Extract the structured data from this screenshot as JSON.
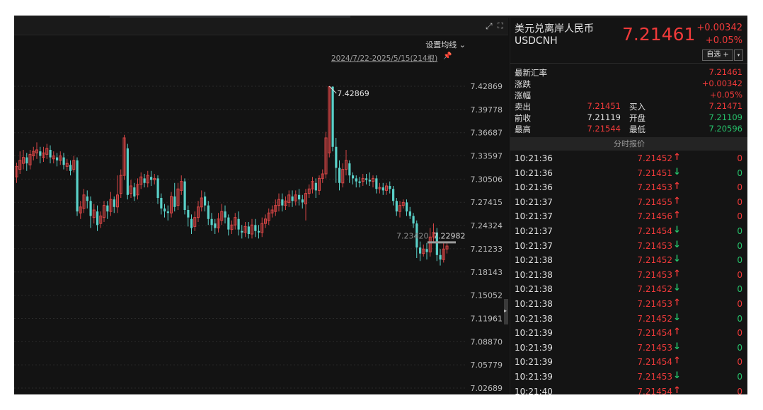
{
  "chart": {
    "ma_setting_label": "设置均线",
    "date_range_label": "2024/7/22-2025/5/15(214根)",
    "high_marker_label": "7.42869",
    "last_price_label": "7.23420",
    "last_price_label_2": "7.22982",
    "y_ticks": [
      "7.42869",
      "7.39778",
      "7.36687",
      "7.33597",
      "7.30506",
      "7.27415",
      "7.24324",
      "7.21233",
      "7.18143",
      "7.15052",
      "7.11961",
      "7.08870",
      "7.05779",
      "7.02689"
    ]
  },
  "chart_data": {
    "type": "candlestick",
    "title": "",
    "ylim": [
      7.02689,
      7.42869
    ],
    "high_marker": 7.42869,
    "last_labels": [
      7.2342,
      7.22982
    ],
    "ohlc": [
      [
        7.308,
        7.322,
        7.3,
        7.327
      ],
      [
        7.318,
        7.33,
        7.312,
        7.342
      ],
      [
        7.326,
        7.334,
        7.318,
        7.344
      ],
      [
        7.334,
        7.326,
        7.316,
        7.34
      ],
      [
        7.324,
        7.338,
        7.318,
        7.344
      ],
      [
        7.336,
        7.342,
        7.33,
        7.348
      ],
      [
        7.34,
        7.344,
        7.332,
        7.354
      ],
      [
        7.342,
        7.336,
        7.326,
        7.348
      ],
      [
        7.334,
        7.34,
        7.328,
        7.348
      ],
      [
        7.338,
        7.346,
        7.332,
        7.352
      ],
      [
        7.344,
        7.334,
        7.326,
        7.35
      ],
      [
        7.332,
        7.336,
        7.326,
        7.342
      ],
      [
        7.334,
        7.33,
        7.322,
        7.34
      ],
      [
        7.33,
        7.336,
        7.324,
        7.342
      ],
      [
        7.334,
        7.324,
        7.318,
        7.34
      ],
      [
        7.322,
        7.326,
        7.316,
        7.332
      ],
      [
        7.324,
        7.316,
        7.31,
        7.33
      ],
      [
        7.318,
        7.33,
        7.314,
        7.336
      ],
      [
        7.33,
        7.262,
        7.256,
        7.334
      ],
      [
        7.26,
        7.268,
        7.252,
        7.276
      ],
      [
        7.266,
        7.284,
        7.26,
        7.292
      ],
      [
        7.282,
        7.276,
        7.266,
        7.29
      ],
      [
        7.276,
        7.256,
        7.24,
        7.282
      ],
      [
        7.254,
        7.264,
        7.246,
        7.272
      ],
      [
        7.262,
        7.244,
        7.236,
        7.27
      ],
      [
        7.246,
        7.256,
        7.24,
        7.262
      ],
      [
        7.254,
        7.27,
        7.248,
        7.276
      ],
      [
        7.27,
        7.262,
        7.252,
        7.276
      ],
      [
        7.262,
        7.278,
        7.256,
        7.288
      ],
      [
        7.278,
        7.268,
        7.26,
        7.282
      ],
      [
        7.268,
        7.284,
        7.26,
        7.31
      ],
      [
        7.286,
        7.31,
        7.28,
        7.318
      ],
      [
        7.31,
        7.36,
        7.304,
        7.364
      ],
      [
        7.346,
        7.284,
        7.278,
        7.352
      ],
      [
        7.286,
        7.296,
        7.28,
        7.304
      ],
      [
        7.294,
        7.282,
        7.276,
        7.3
      ],
      [
        7.284,
        7.298,
        7.278,
        7.306
      ],
      [
        7.298,
        7.308,
        7.292,
        7.314
      ],
      [
        7.306,
        7.3,
        7.294,
        7.312
      ],
      [
        7.3,
        7.31,
        7.294,
        7.316
      ],
      [
        7.308,
        7.304,
        7.296,
        7.316
      ],
      [
        7.304,
        7.306,
        7.298,
        7.312
      ],
      [
        7.306,
        7.28,
        7.272,
        7.31
      ],
      [
        7.28,
        7.266,
        7.258,
        7.286
      ],
      [
        7.266,
        7.262,
        7.254,
        7.272
      ],
      [
        7.262,
        7.26,
        7.25,
        7.27
      ],
      [
        7.26,
        7.282,
        7.254,
        7.288
      ],
      [
        7.282,
        7.268,
        7.262,
        7.3
      ],
      [
        7.27,
        7.292,
        7.264,
        7.3
      ],
      [
        7.29,
        7.302,
        7.284,
        7.31
      ],
      [
        7.302,
        7.264,
        7.258,
        7.306
      ],
      [
        7.264,
        7.254,
        7.242,
        7.27
      ],
      [
        7.252,
        7.24,
        7.232,
        7.258
      ],
      [
        7.242,
        7.254,
        7.236,
        7.262
      ],
      [
        7.254,
        7.268,
        7.248,
        7.276
      ],
      [
        7.268,
        7.28,
        7.262,
        7.29
      ],
      [
        7.282,
        7.27,
        7.262,
        7.288
      ],
      [
        7.27,
        7.252,
        7.244,
        7.276
      ],
      [
        7.252,
        7.244,
        7.236,
        7.26
      ],
      [
        7.246,
        7.24,
        7.232,
        7.252
      ],
      [
        7.24,
        7.252,
        7.234,
        7.26
      ],
      [
        7.25,
        7.262,
        7.244,
        7.272
      ],
      [
        7.262,
        7.254,
        7.246,
        7.27
      ],
      [
        7.254,
        7.238,
        7.23,
        7.258
      ],
      [
        7.238,
        7.244,
        7.232,
        7.25
      ],
      [
        7.244,
        7.254,
        7.238,
        7.26
      ],
      [
        7.252,
        7.238,
        7.23,
        7.262
      ],
      [
        7.236,
        7.234,
        7.226,
        7.244
      ],
      [
        7.234,
        7.242,
        7.228,
        7.248
      ],
      [
        7.242,
        7.232,
        7.226,
        7.248
      ],
      [
        7.232,
        7.244,
        7.226,
        7.252
      ],
      [
        7.244,
        7.236,
        7.228,
        7.252
      ],
      [
        7.236,
        7.234,
        7.226,
        7.244
      ],
      [
        7.234,
        7.246,
        7.228,
        7.254
      ],
      [
        7.246,
        7.252,
        7.24,
        7.258
      ],
      [
        7.25,
        7.26,
        7.244,
        7.266
      ],
      [
        7.26,
        7.264,
        7.254,
        7.27
      ],
      [
        7.262,
        7.27,
        7.256,
        7.278
      ],
      [
        7.27,
        7.278,
        7.262,
        7.286
      ],
      [
        7.278,
        7.27,
        7.262,
        7.286
      ],
      [
        7.27,
        7.276,
        7.264,
        7.282
      ],
      [
        7.274,
        7.284,
        7.268,
        7.29
      ],
      [
        7.282,
        7.276,
        7.268,
        7.29
      ],
      [
        7.276,
        7.284,
        7.27,
        7.29
      ],
      [
        7.284,
        7.278,
        7.27,
        7.292
      ],
      [
        7.278,
        7.274,
        7.266,
        7.284
      ],
      [
        7.272,
        7.286,
        7.25,
        7.292
      ],
      [
        7.286,
        7.292,
        7.28,
        7.298
      ],
      [
        7.292,
        7.302,
        7.286,
        7.308
      ],
      [
        7.3,
        7.29,
        7.28,
        7.306
      ],
      [
        7.29,
        7.306,
        7.284,
        7.31
      ],
      [
        7.306,
        7.312,
        7.3,
        7.318
      ],
      [
        7.312,
        7.36,
        7.306,
        7.368
      ],
      [
        7.34,
        7.428,
        7.334,
        7.42869
      ],
      [
        7.428,
        7.348,
        7.342,
        7.42869
      ],
      [
        7.348,
        7.32,
        7.3,
        7.36
      ],
      [
        7.32,
        7.3,
        7.29,
        7.33
      ],
      [
        7.3,
        7.318,
        7.294,
        7.326
      ],
      [
        7.318,
        7.33,
        7.31,
        7.344
      ],
      [
        7.326,
        7.31,
        7.3,
        7.33
      ],
      [
        7.31,
        7.306,
        7.298,
        7.314
      ],
      [
        7.306,
        7.302,
        7.294,
        7.31
      ],
      [
        7.302,
        7.3,
        7.294,
        7.308
      ],
      [
        7.302,
        7.306,
        7.296,
        7.312
      ],
      [
        7.306,
        7.304,
        7.298,
        7.312
      ],
      [
        7.304,
        7.302,
        7.296,
        7.314
      ],
      [
        7.302,
        7.306,
        7.294,
        7.31
      ],
      [
        7.306,
        7.292,
        7.286,
        7.31
      ],
      [
        7.292,
        7.294,
        7.286,
        7.3
      ],
      [
        7.294,
        7.29,
        7.284,
        7.3
      ],
      [
        7.29,
        7.296,
        7.284,
        7.3
      ],
      [
        7.296,
        7.292,
        7.286,
        7.302
      ],
      [
        7.292,
        7.276,
        7.27,
        7.296
      ],
      [
        7.276,
        7.262,
        7.256,
        7.28
      ],
      [
        7.262,
        7.27,
        7.254,
        7.276
      ],
      [
        7.27,
        7.274,
        7.266,
        7.278
      ],
      [
        7.274,
        7.262,
        7.256,
        7.278
      ],
      [
        7.262,
        7.256,
        7.252,
        7.268
      ],
      [
        7.256,
        7.246,
        7.24,
        7.26
      ],
      [
        7.246,
        7.214,
        7.2,
        7.25
      ],
      [
        7.214,
        7.206,
        7.196,
        7.222
      ],
      [
        7.206,
        7.212,
        7.202,
        7.218
      ],
      [
        7.212,
        7.208,
        7.198,
        7.22
      ],
      [
        7.208,
        7.228,
        7.202,
        7.24
      ],
      [
        7.228,
        7.234,
        7.222,
        7.246
      ],
      [
        7.234,
        7.204,
        7.196,
        7.24
      ],
      [
        7.204,
        7.198,
        7.19,
        7.212
      ],
      [
        7.198,
        7.212,
        7.194,
        7.222
      ],
      [
        7.212,
        7.216,
        7.206,
        7.222
      ]
    ]
  },
  "quote": {
    "name": "美元兑离岸人民币",
    "code": "USDCNH",
    "price": "7.21461",
    "change": "+0.00342",
    "change_pct": "+0.05%",
    "watch_label": "自选 +",
    "watch_dropdown": "▾",
    "stats": {
      "latest_label": "最新汇率",
      "latest": "7.21461",
      "chg_label": "涨跌",
      "chg": "+0.00342",
      "pct_label": "涨幅",
      "pct": "+0.05%",
      "sell_label": "卖出",
      "sell": "7.21451",
      "buy_label": "买入",
      "buy": "7.21471",
      "prev_label": "前收",
      "prev": "7.21119",
      "open_label": "开盘",
      "open": "7.21109",
      "high_label": "最高",
      "high": "7.21544",
      "low_label": "最低",
      "low": "7.20596"
    },
    "ticks_header": "分时报价",
    "ticks": [
      {
        "time": "10:21:36",
        "price": "7.21452",
        "dir": "up",
        "vol": "0"
      },
      {
        "time": "10:21:36",
        "price": "7.21451",
        "dir": "down",
        "vol": "0"
      },
      {
        "time": "10:21:36",
        "price": "7.21453",
        "dir": "up",
        "vol": "0"
      },
      {
        "time": "10:21:37",
        "price": "7.21455",
        "dir": "up",
        "vol": "0"
      },
      {
        "time": "10:21:37",
        "price": "7.21456",
        "dir": "up",
        "vol": "0"
      },
      {
        "time": "10:21:37",
        "price": "7.21454",
        "dir": "down",
        "vol": "0"
      },
      {
        "time": "10:21:37",
        "price": "7.21453",
        "dir": "down",
        "vol": "0"
      },
      {
        "time": "10:21:38",
        "price": "7.21452",
        "dir": "down",
        "vol": "0"
      },
      {
        "time": "10:21:38",
        "price": "7.21453",
        "dir": "up",
        "vol": "0"
      },
      {
        "time": "10:21:38",
        "price": "7.21452",
        "dir": "down",
        "vol": "0"
      },
      {
        "time": "10:21:38",
        "price": "7.21453",
        "dir": "up",
        "vol": "0"
      },
      {
        "time": "10:21:38",
        "price": "7.21452",
        "dir": "down",
        "vol": "0"
      },
      {
        "time": "10:21:39",
        "price": "7.21454",
        "dir": "up",
        "vol": "0"
      },
      {
        "time": "10:21:39",
        "price": "7.21453",
        "dir": "down",
        "vol": "0"
      },
      {
        "time": "10:21:39",
        "price": "7.21454",
        "dir": "up",
        "vol": "0"
      },
      {
        "time": "10:21:39",
        "price": "7.21453",
        "dir": "down",
        "vol": "0"
      },
      {
        "time": "10:21:40",
        "price": "7.21454",
        "dir": "up",
        "vol": "0"
      }
    ],
    "colors": {
      "up": "#f03a3a",
      "down": "#26c26b",
      "candle_up": "#d64545",
      "candle_down": "#5ad1c9"
    }
  }
}
